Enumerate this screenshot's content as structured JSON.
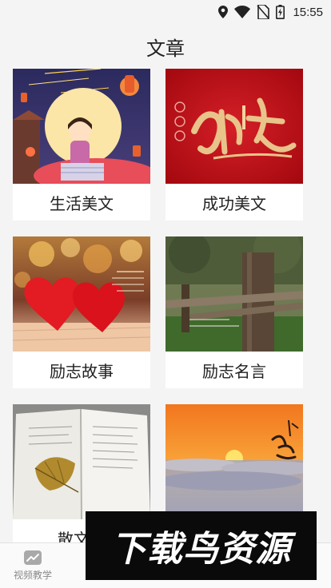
{
  "status_bar": {
    "time": "15:55",
    "icons": [
      "location-icon",
      "wifi-icon",
      "no-sim-icon",
      "battery-charging-icon"
    ]
  },
  "header": {
    "title": "文章"
  },
  "categories": [
    {
      "label": "生活美文",
      "image": "moon-girl-lanterns-illustration"
    },
    {
      "label": "成功美文",
      "image": "red-calligraphy-chengqin"
    },
    {
      "label": "励志故事",
      "image": "two-red-hearts-bokeh"
    },
    {
      "label": "励志名言",
      "image": "wooden-fence-post"
    },
    {
      "label": "散文精",
      "image": "open-book-leaf"
    },
    {
      "label": "",
      "image": "sunset-sea-of-clouds"
    }
  ],
  "tabbar": {
    "items": [
      {
        "label": "视频教学",
        "icon": "trend-chart-icon"
      }
    ]
  },
  "watermark": {
    "text": "下载鸟资源"
  },
  "colors": {
    "background": "#f4f4f4",
    "card": "#ffffff",
    "tab_label": "#8a8a8a"
  }
}
